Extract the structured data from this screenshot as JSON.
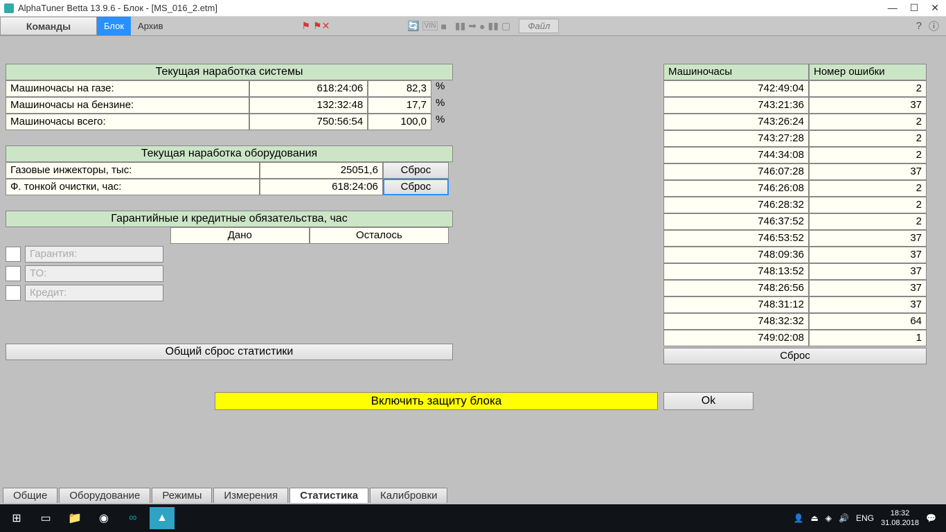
{
  "window": {
    "title": "AlphaTuner Betta 13.9.6 - Блок - [MS_016_2.etm]"
  },
  "menubar": {
    "commands": "Команды",
    "block": "Блок",
    "archive": "Архив",
    "file_btn": "Файл"
  },
  "sections": {
    "sys_header": "Текущая наработка системы",
    "rows": [
      {
        "label": "Машиночасы на газе:",
        "time": "618:24:06",
        "pct": "82,3",
        "unit": "%"
      },
      {
        "label": "Машиночасы на бензине:",
        "time": "132:32:48",
        "pct": "17,7",
        "unit": "%"
      },
      {
        "label": "Машиночасы всего:",
        "time": "750:56:54",
        "pct": "100,0",
        "unit": "%"
      }
    ],
    "equip_header": "Текущая наработка оборудования",
    "erows": [
      {
        "label": "Газовые инжекторы, тыс:",
        "val": "25051,6",
        "btn": "Сброс"
      },
      {
        "label": "Ф. тонкой очистки, час:",
        "val": "618:24:06",
        "btn": "Сброс"
      }
    ],
    "warranty_header": "Гарантийные и кредитные обязательства, час",
    "wcols": {
      "given": "Дано",
      "left": "Осталось"
    },
    "wrows": [
      {
        "label": "Гарантия:"
      },
      {
        "label": "ТО:"
      },
      {
        "label": "Кредит:"
      }
    ],
    "reset_all": "Общий сброс статистики"
  },
  "errors": {
    "h1": "Машиночасы",
    "h2": "Номер ошибки",
    "rows": [
      {
        "t": "742:49:04",
        "e": "2"
      },
      {
        "t": "743:21:36",
        "e": "37"
      },
      {
        "t": "743:26:24",
        "e": "2"
      },
      {
        "t": "743:27:28",
        "e": "2"
      },
      {
        "t": "744:34:08",
        "e": "2"
      },
      {
        "t": "746:07:28",
        "e": "37"
      },
      {
        "t": "746:26:08",
        "e": "2"
      },
      {
        "t": "746:28:32",
        "e": "2"
      },
      {
        "t": "746:37:52",
        "e": "2"
      },
      {
        "t": "746:53:52",
        "e": "37"
      },
      {
        "t": "748:09:36",
        "e": "37"
      },
      {
        "t": "748:13:52",
        "e": "37"
      },
      {
        "t": "748:26:56",
        "e": "37"
      },
      {
        "t": "748:31:12",
        "e": "37"
      },
      {
        "t": "748:32:32",
        "e": "64"
      },
      {
        "t": "749:02:08",
        "e": "1"
      }
    ],
    "reset": "Сброс"
  },
  "protect": {
    "label": "Включить защиту блока",
    "ok": "Ok"
  },
  "tabs": [
    "Общие",
    "Оборудование",
    "Режимы",
    "Измерения",
    "Статистика",
    "Калибровки"
  ],
  "active_tab": 4,
  "taskbar": {
    "lang": "ENG",
    "time": "18:32",
    "date": "31.08.2018"
  }
}
